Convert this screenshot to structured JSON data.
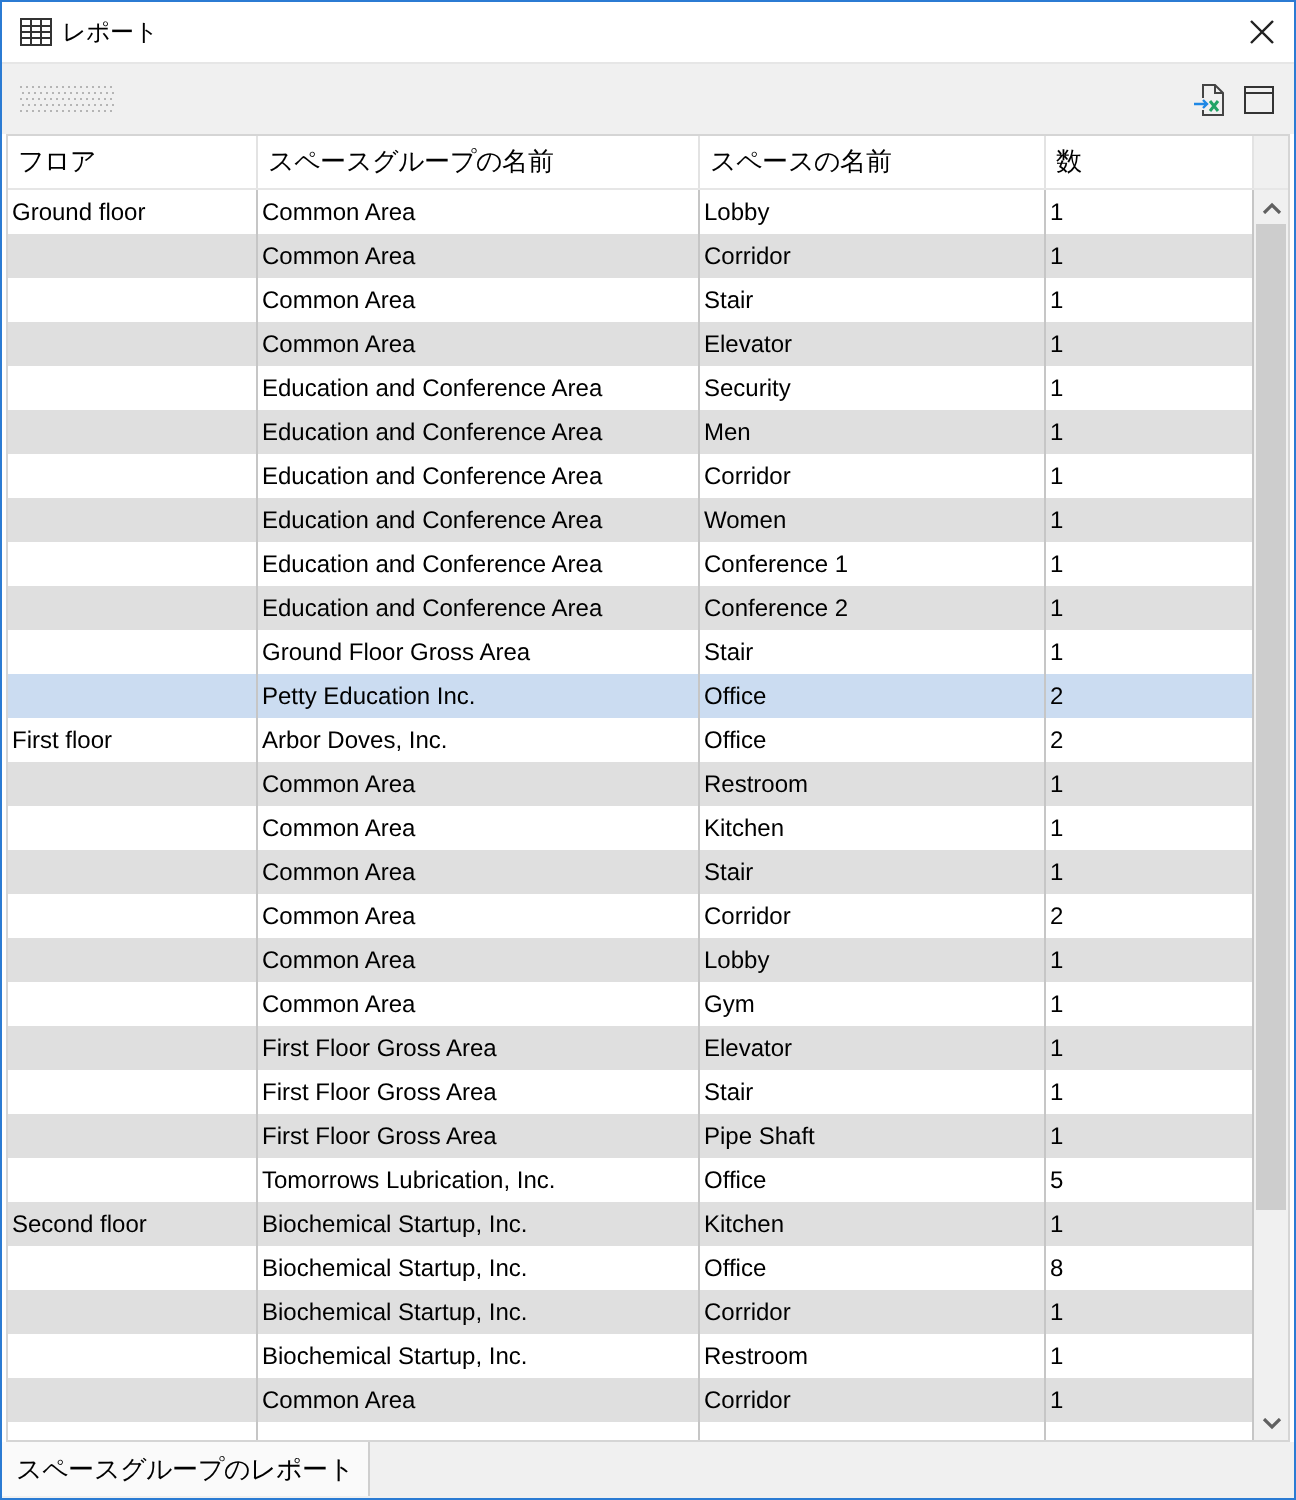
{
  "window": {
    "title": "レポート"
  },
  "table": {
    "columns": [
      "フロア",
      "スペースグループの名前",
      "スペースの名前",
      "数"
    ],
    "rows": [
      {
        "floor": "Ground floor",
        "space_group": "Common Area",
        "space": "Lobby",
        "count": "1",
        "selected": false
      },
      {
        "space_group": "Common Area",
        "space": "Corridor",
        "count": "1",
        "selected": false
      },
      {
        "space_group": "Common Area",
        "space": "Stair",
        "count": "1",
        "selected": false
      },
      {
        "space_group": "Common Area",
        "space": "Elevator",
        "count": "1",
        "selected": false
      },
      {
        "space_group": "Education and Conference Area",
        "space": "Security",
        "count": "1",
        "selected": false
      },
      {
        "space_group": "Education and Conference Area",
        "space": "Men",
        "count": "1",
        "selected": false
      },
      {
        "space_group": "Education and Conference Area",
        "space": "Corridor",
        "count": "1",
        "selected": false
      },
      {
        "space_group": "Education and Conference Area",
        "space": "Women",
        "count": "1",
        "selected": false
      },
      {
        "space_group": "Education and Conference Area",
        "space": "Conference 1",
        "count": "1",
        "selected": false
      },
      {
        "space_group": "Education and Conference Area",
        "space": "Conference 2",
        "count": "1",
        "selected": false
      },
      {
        "space_group": "Ground Floor Gross Area",
        "space": "Stair",
        "count": "1",
        "selected": false
      },
      {
        "space_group": "Petty Education Inc.",
        "space": "Office",
        "count": "2",
        "selected": true
      },
      {
        "floor": "First floor",
        "space_group": "Arbor Doves, Inc.",
        "space": "Office",
        "count": "2",
        "selected": false
      },
      {
        "space_group": "Common Area",
        "space": "Restroom",
        "count": "1",
        "selected": false
      },
      {
        "space_group": "Common Area",
        "space": "Kitchen",
        "count": "1",
        "selected": false
      },
      {
        "space_group": "Common Area",
        "space": "Stair",
        "count": "1",
        "selected": false
      },
      {
        "space_group": "Common Area",
        "space": "Corridor",
        "count": "2",
        "selected": false
      },
      {
        "space_group": "Common Area",
        "space": "Lobby",
        "count": "1",
        "selected": false
      },
      {
        "space_group": "Common Area",
        "space": "Gym",
        "count": "1",
        "selected": false
      },
      {
        "space_group": "First Floor Gross Area",
        "space": "Elevator",
        "count": "1",
        "selected": false
      },
      {
        "space_group": "First Floor Gross Area",
        "space": "Stair",
        "count": "1",
        "selected": false
      },
      {
        "space_group": "First Floor Gross Area",
        "space": "Pipe Shaft",
        "count": "1",
        "selected": false
      },
      {
        "space_group": "Tomorrows Lubrication, Inc.",
        "space": "Office",
        "count": "5",
        "selected": false
      },
      {
        "floor": "Second floor",
        "space_group": "Biochemical Startup, Inc.",
        "space": "Kitchen",
        "count": "1",
        "selected": false
      },
      {
        "space_group": "Biochemical Startup, Inc.",
        "space": "Office",
        "count": "8",
        "selected": false
      },
      {
        "space_group": "Biochemical Startup, Inc.",
        "space": "Corridor",
        "count": "1",
        "selected": false
      },
      {
        "space_group": "Biochemical Startup, Inc.",
        "space": "Restroom",
        "count": "1",
        "selected": false
      },
      {
        "space_group": "Common Area",
        "space": "Corridor",
        "count": "1",
        "selected": false
      }
    ]
  },
  "bottom_tabs": [
    {
      "label": "スペースグループのレポート",
      "selected": true
    }
  ]
}
